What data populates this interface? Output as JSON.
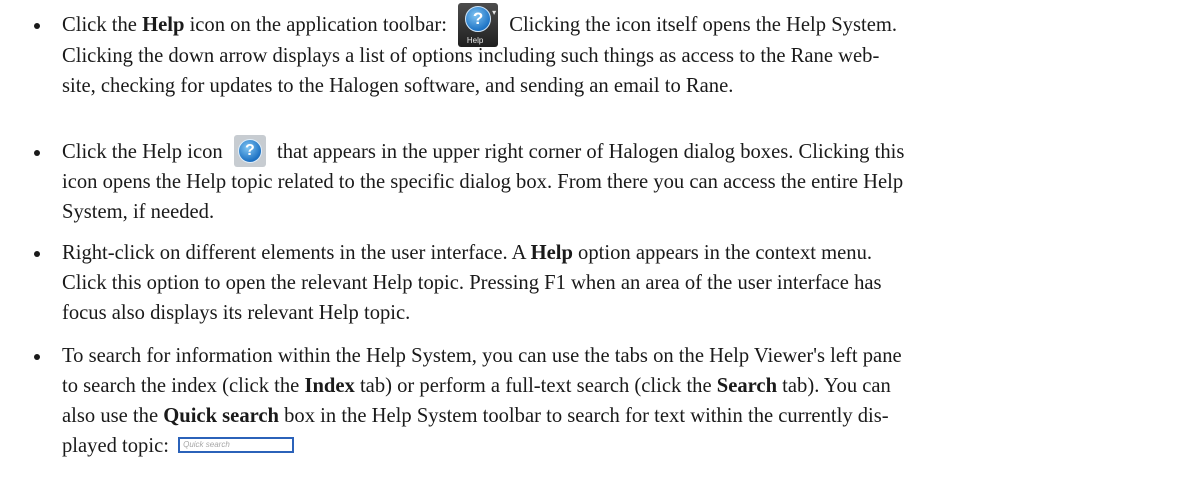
{
  "items": [
    {
      "line1": {
        "a": "Click the ",
        "b": "Help",
        "c": " icon on the application toolbar: ",
        "d": " Clicking the icon itself opens the Help System."
      },
      "line2": "Clicking the down arrow displays a list of options including such things as access to the Rane web-",
      "line3": "site, checking for updates to the Halogen software, and sending an email to Rane.",
      "icon_caption": "Help",
      "icon_arrow": "▾"
    },
    {
      "line1": {
        "a": "Click the Help icon ",
        "d": " that appears in the upper right corner of Halogen dialog boxes. Clicking this"
      },
      "line2": "icon opens the Help topic related to the specific dialog box. From there you can access the entire Help",
      "line3": "System, if needed.",
      "icon_glyph": "?"
    },
    {
      "line1": {
        "a": "Right-click on different elements in the user interface. A ",
        "b": "Help",
        "c": " option appears in the context menu."
      },
      "line2": "Click this option to open the relevant Help topic. Pressing F1 when an area of the user interface has",
      "line3": "focus also displays its relevant Help topic."
    },
    {
      "line1": "To search for information within the Help System, you can use the tabs on the Help Viewer's left pane",
      "line2": {
        "a": "to search the index (click the ",
        "b": "Index",
        "c": " tab) or perform a full-text search (click the ",
        "d": "Search",
        "e": " tab). You can"
      },
      "line3": {
        "a": "also use the ",
        "b": "Quick search",
        "c": " box in the Help System toolbar to search for text within the currently dis-"
      },
      "line4": "played topic: ",
      "search_placeholder": "Quick search"
    }
  ],
  "icons": {
    "toolbar_help_glyph": "?"
  }
}
